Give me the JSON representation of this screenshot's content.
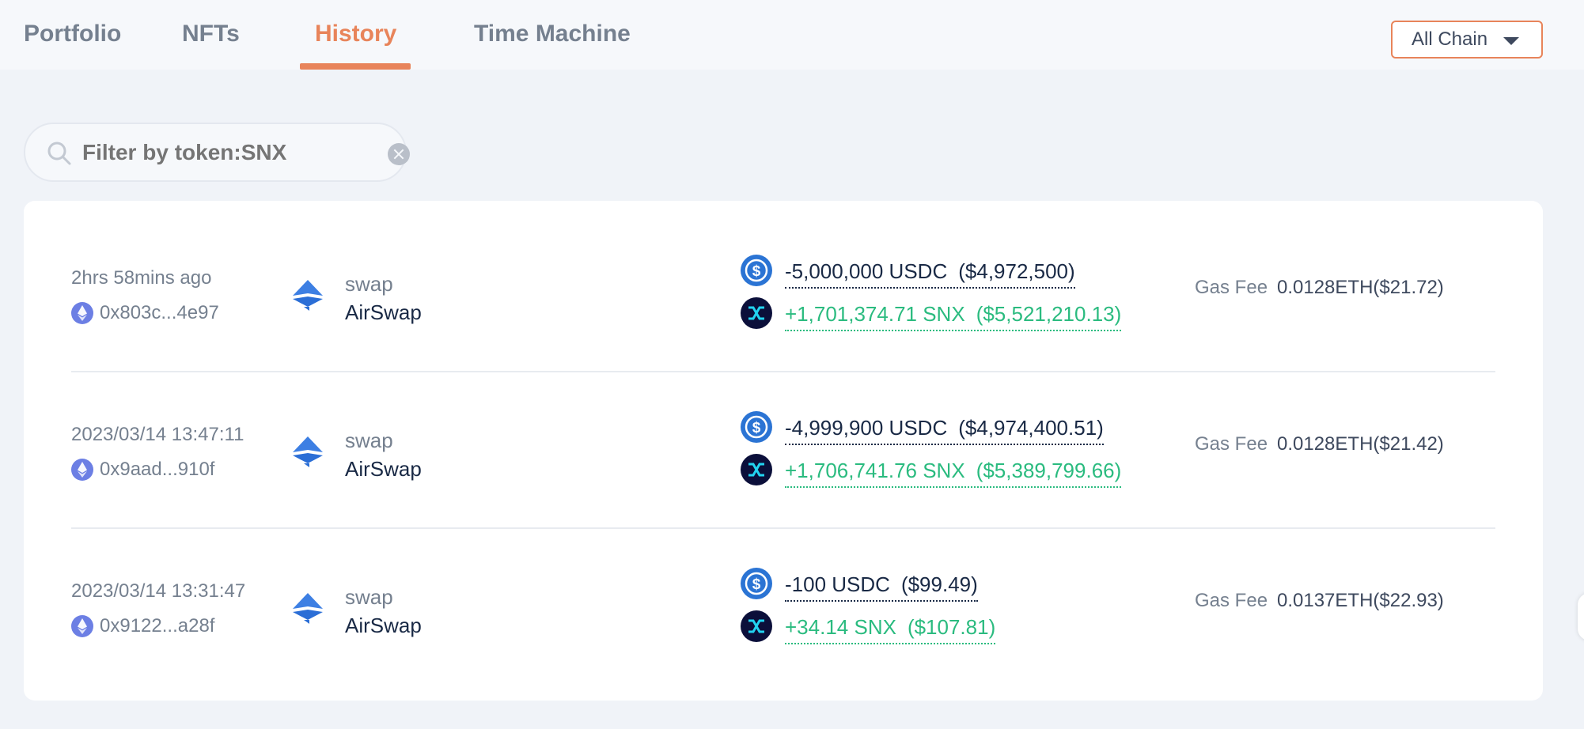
{
  "tabs": [
    {
      "label": "Portfolio"
    },
    {
      "label": "NFTs"
    },
    {
      "label": "History"
    },
    {
      "label": "Time Machine"
    }
  ],
  "active_tab": "History",
  "chain_select": {
    "value": "All Chain"
  },
  "search": {
    "placeholder": "Filter by token:SNX"
  },
  "gas_label": "Gas Fee",
  "colors": {
    "accent": "#e8845a",
    "positive": "#2abb7f",
    "text": "#192945",
    "muted": "#75808f"
  },
  "transactions": [
    {
      "time": "2hrs 58mins ago",
      "address": "0x803c...4e97",
      "type": "swap",
      "protocol": "AirSwap",
      "sent": {
        "amount": "-5,000,000 USDC",
        "usd": "($4,972,500)"
      },
      "received": {
        "amount": "+1,701,374.71 SNX",
        "usd": "($5,521,210.13)"
      },
      "gas_fee": "0.0128ETH($21.72)"
    },
    {
      "time": "2023/03/14 13:47:11",
      "address": "0x9aad...910f",
      "type": "swap",
      "protocol": "AirSwap",
      "sent": {
        "amount": "-4,999,900 USDC",
        "usd": "($4,974,400.51)"
      },
      "received": {
        "amount": "+1,706,741.76 SNX",
        "usd": "($5,389,799.66)"
      },
      "gas_fee": "0.0128ETH($21.42)"
    },
    {
      "time": "2023/03/14 13:31:47",
      "address": "0x9122...a28f",
      "type": "swap",
      "protocol": "AirSwap",
      "sent": {
        "amount": "-100 USDC",
        "usd": "($99.49)"
      },
      "received": {
        "amount": "+34.14 SNX",
        "usd": "($107.81)"
      },
      "gas_fee": "0.0137ETH($22.93)"
    }
  ]
}
